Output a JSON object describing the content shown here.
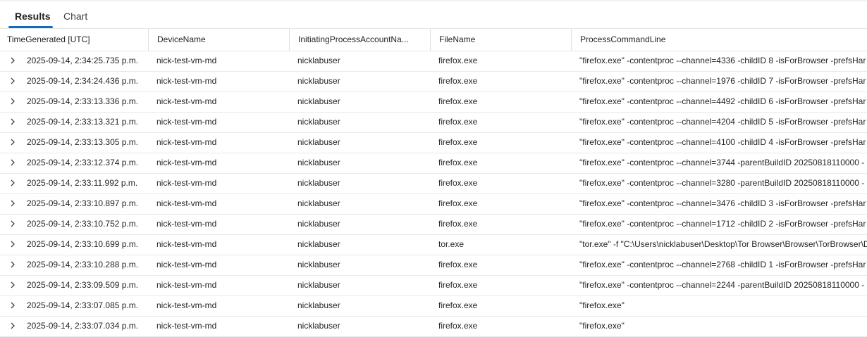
{
  "tabs": [
    {
      "label": "Results",
      "active": true
    },
    {
      "label": "Chart",
      "active": false
    }
  ],
  "accent_color": "#0f6cbd",
  "columns": [
    "TimeGenerated [UTC]",
    "DeviceName",
    "InitiatingProcessAccountNa...",
    "FileName",
    "ProcessCommandLine"
  ],
  "expand_icon": "chevron-right-icon",
  "rows": [
    [
      "2025-09-14, 2:34:25.735 p.m.",
      "nick-test-vm-md",
      "nicklabuser",
      "firefox.exe",
      "\"firefox.exe\" -contentproc --channel=4336 -childID 8 -isForBrowser -prefsHar"
    ],
    [
      "2025-09-14, 2:34:24.436 p.m.",
      "nick-test-vm-md",
      "nicklabuser",
      "firefox.exe",
      "\"firefox.exe\" -contentproc --channel=1976 -childID 7 -isForBrowser -prefsHar"
    ],
    [
      "2025-09-14, 2:33:13.336 p.m.",
      "nick-test-vm-md",
      "nicklabuser",
      "firefox.exe",
      "\"firefox.exe\" -contentproc --channel=4492 -childID 6 -isForBrowser -prefsHar"
    ],
    [
      "2025-09-14, 2:33:13.321 p.m.",
      "nick-test-vm-md",
      "nicklabuser",
      "firefox.exe",
      "\"firefox.exe\" -contentproc --channel=4204 -childID 5 -isForBrowser -prefsHar"
    ],
    [
      "2025-09-14, 2:33:13.305 p.m.",
      "nick-test-vm-md",
      "nicklabuser",
      "firefox.exe",
      "\"firefox.exe\" -contentproc --channel=4100 -childID 4 -isForBrowser -prefsHar"
    ],
    [
      "2025-09-14, 2:33:12.374 p.m.",
      "nick-test-vm-md",
      "nicklabuser",
      "firefox.exe",
      "\"firefox.exe\" -contentproc --channel=3744 -parentBuildID 20250818110000 -"
    ],
    [
      "2025-09-14, 2:33:11.992 p.m.",
      "nick-test-vm-md",
      "nicklabuser",
      "firefox.exe",
      "\"firefox.exe\" -contentproc --channel=3280 -parentBuildID 20250818110000 -"
    ],
    [
      "2025-09-14, 2:33:10.897 p.m.",
      "nick-test-vm-md",
      "nicklabuser",
      "firefox.exe",
      "\"firefox.exe\" -contentproc --channel=3476 -childID 3 -isForBrowser -prefsHar"
    ],
    [
      "2025-09-14, 2:33:10.752 p.m.",
      "nick-test-vm-md",
      "nicklabuser",
      "firefox.exe",
      "\"firefox.exe\" -contentproc --channel=1712 -childID 2 -isForBrowser -prefsHar"
    ],
    [
      "2025-09-14, 2:33:10.699 p.m.",
      "nick-test-vm-md",
      "nicklabuser",
      "tor.exe",
      "\"tor.exe\" -f \"C:\\Users\\nicklabuser\\Desktop\\Tor Browser\\Browser\\TorBrowser\\D"
    ],
    [
      "2025-09-14, 2:33:10.288 p.m.",
      "nick-test-vm-md",
      "nicklabuser",
      "firefox.exe",
      "\"firefox.exe\" -contentproc --channel=2768 -childID 1 -isForBrowser -prefsHar"
    ],
    [
      "2025-09-14, 2:33:09.509 p.m.",
      "nick-test-vm-md",
      "nicklabuser",
      "firefox.exe",
      "\"firefox.exe\" -contentproc --channel=2244 -parentBuildID 20250818110000 -"
    ],
    [
      "2025-09-14, 2:33:07.085 p.m.",
      "nick-test-vm-md",
      "nicklabuser",
      "firefox.exe",
      "\"firefox.exe\""
    ],
    [
      "2025-09-14, 2:33:07.034 p.m.",
      "nick-test-vm-md",
      "nicklabuser",
      "firefox.exe",
      "\"firefox.exe\""
    ]
  ]
}
